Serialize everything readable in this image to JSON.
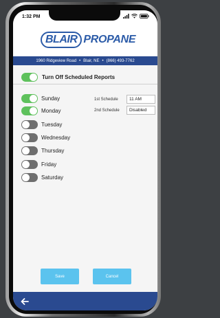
{
  "status_bar": {
    "time": "1:32 PM"
  },
  "brand": {
    "pill_text": "BLAIR",
    "name_text": "PROPANE"
  },
  "address_bar": {
    "street": "1960 Ridgeview Road",
    "sep1": "•",
    "city": "Blair, NE",
    "sep2": "•",
    "phone": "(866) 493-7762"
  },
  "scheduled_reports": {
    "label": "Turn Off Scheduled Reports",
    "enabled": true
  },
  "days": [
    {
      "label": "Sunday",
      "enabled": true
    },
    {
      "label": "Monday",
      "enabled": true
    },
    {
      "label": "Tuesday",
      "enabled": false
    },
    {
      "label": "Wednesday",
      "enabled": false
    },
    {
      "label": "Thursday",
      "enabled": false
    },
    {
      "label": "Friday",
      "enabled": false
    },
    {
      "label": "Saturday",
      "enabled": false
    }
  ],
  "schedule": {
    "first": {
      "label": "1st Schedule",
      "value": "11 AM"
    },
    "second": {
      "label": "2nd Schedule",
      "value": "Disabled"
    }
  },
  "actions": {
    "save_label": "Save",
    "cancel_label": "Cancel"
  },
  "colors": {
    "brand_blue": "#2b5ba8",
    "bar_navy": "#2a4a90",
    "toggle_on": "#5ec15c",
    "toggle_off": "#6e6e6e",
    "button_blue": "#5bc3ee"
  },
  "icons": {
    "signal": "cellular-signal-icon",
    "wifi": "wifi-icon",
    "battery": "battery-icon",
    "back": "back-arrow-icon"
  }
}
